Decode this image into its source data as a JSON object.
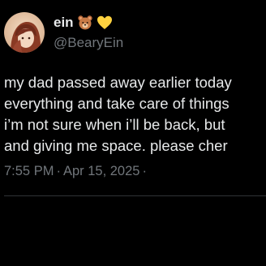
{
  "author": {
    "display_name": "ein",
    "handle": "@BearyEin",
    "name_emojis": [
      "bear-face-emoji",
      "yellow-heart-emoji"
    ]
  },
  "tweet": {
    "lines": [
      "my dad passed away earlier today",
      "everything and take care of things",
      "i’m not sure when i’ll be back, but",
      "and giving me space.  please cher"
    ]
  },
  "meta": {
    "time": "7:55 PM",
    "separator": "·",
    "date": "Apr 15, 2025",
    "trailing_separator": "·"
  },
  "colors": {
    "background": "#000000",
    "primary_text": "#e7e9ea",
    "secondary_text": "#71767b",
    "divider": "#2f3336"
  }
}
